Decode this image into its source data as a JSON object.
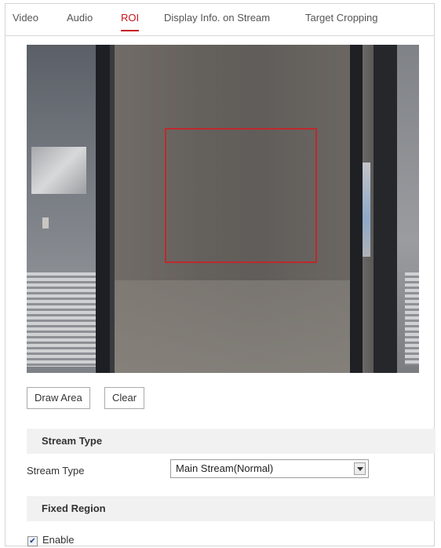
{
  "tabs": [
    {
      "label": "Video",
      "active": false
    },
    {
      "label": "Audio",
      "active": false
    },
    {
      "label": "ROI",
      "active": true
    },
    {
      "label": "Display Info. on Stream",
      "active": false
    },
    {
      "label": "Target Cropping",
      "active": false
    }
  ],
  "buttons": {
    "draw_area": "Draw Area",
    "clear": "Clear"
  },
  "stream_type_section": {
    "title": "Stream Type",
    "field_label": "Stream Type",
    "selected_value": "Main Stream(Normal)"
  },
  "fixed_region_section": {
    "title": "Fixed Region",
    "enable_label": "Enable",
    "enable_checked": true
  },
  "colors": {
    "accent": "#c8141e",
    "roi_box": "#c0282e"
  }
}
